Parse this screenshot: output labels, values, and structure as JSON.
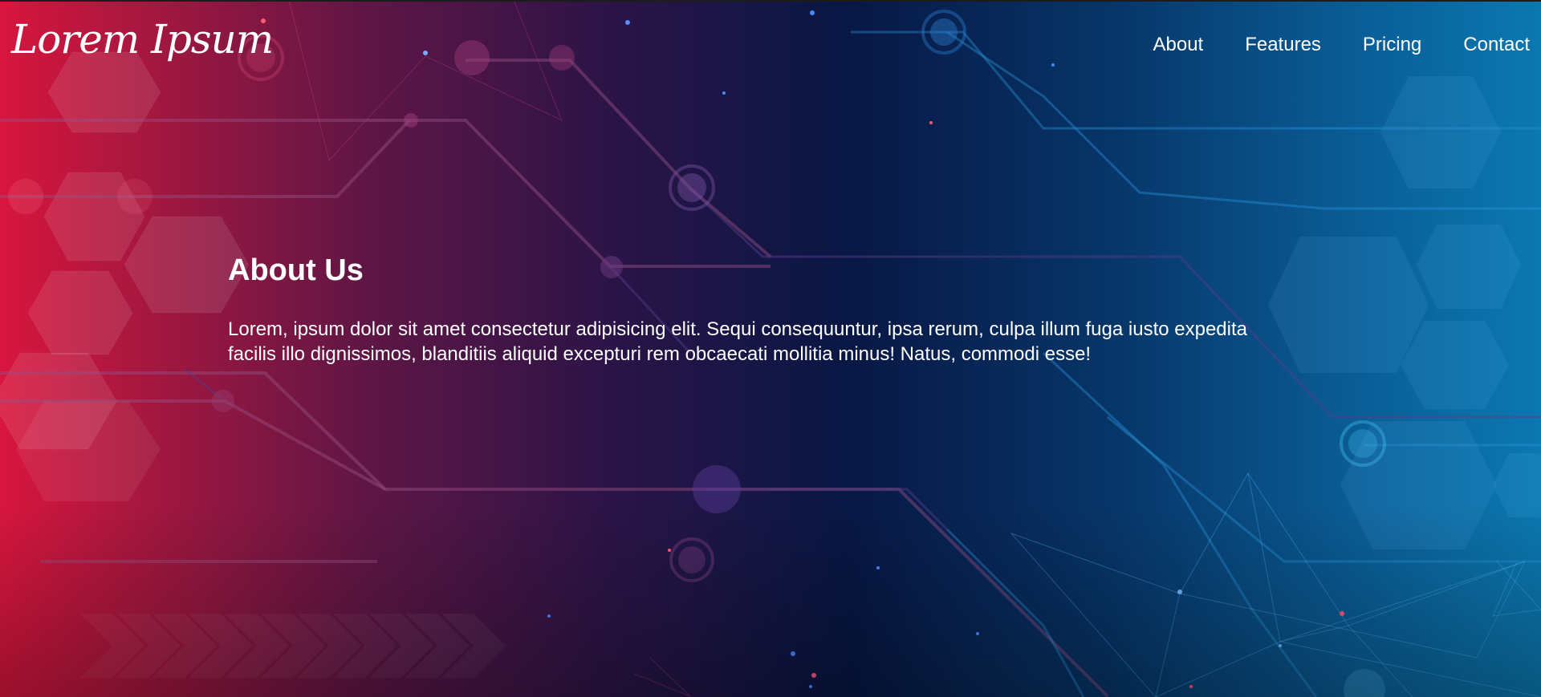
{
  "brand": {
    "logo_text": "Lorem Ipsum"
  },
  "nav": {
    "items": [
      {
        "label": "About"
      },
      {
        "label": "Features"
      },
      {
        "label": "Pricing"
      },
      {
        "label": "Contact"
      }
    ]
  },
  "about": {
    "heading": "About Us",
    "body": "Lorem, ipsum dolor sit amet consectetur adipisicing elit. Sequi consequuntur, ipsa rerum, culpa illum fuga iusto expedita facilis illo dignissimos, blanditiis aliquid excepturi rem obcaecati mollitia minus! Natus, commodi esse!"
  },
  "colors": {
    "gradient_left": "#d8163e",
    "gradient_mid": "#081744",
    "gradient_right": "#0b78b0",
    "text": "#ffffff"
  }
}
